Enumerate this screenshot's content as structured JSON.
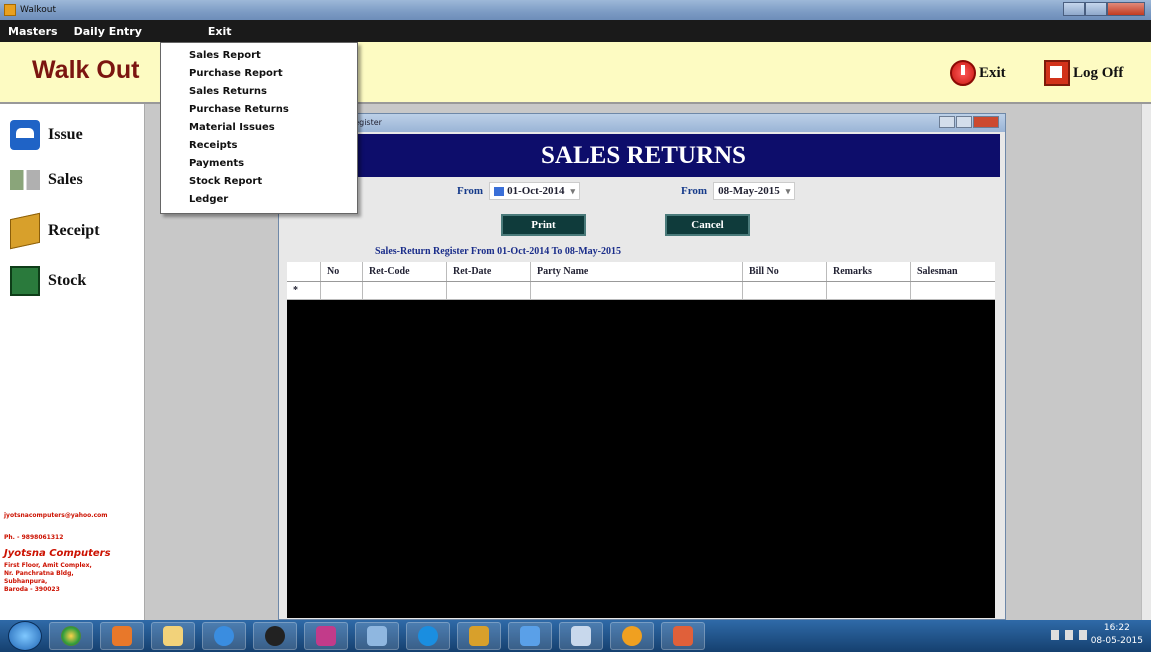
{
  "window": {
    "title": "Walkout"
  },
  "menubar": {
    "items": [
      "Masters",
      "Daily Entry",
      "Exit"
    ]
  },
  "dropdown": {
    "items": [
      "Sales Report",
      "Purchase Report",
      "Sales Returns",
      "Purchase Returns",
      "Material Issues",
      "Receipts",
      "Payments",
      "Stock Report",
      "Ledger"
    ]
  },
  "header": {
    "brand": "Walk Out",
    "exit_label": "Exit",
    "logoff_label": "Log Off"
  },
  "sidebar": {
    "items": [
      {
        "label": "Issue",
        "icon": "issue-icon"
      },
      {
        "label": "Sales",
        "icon": "sales-icon"
      },
      {
        "label": "Receipt",
        "icon": "receipt-icon"
      },
      {
        "label": "Stock",
        "icon": "stock-icon"
      }
    ],
    "contact": {
      "email": "jyotsnacomputers@yahoo.com",
      "phone": "Ph. - 9898061312",
      "company": "Jyotsna Computers",
      "address1": "First Floor, Amit Complex,",
      "address2": "Nr. Panchratna Bldg,",
      "address3": "Subhanpura,",
      "address4": "Baroda - 390023"
    }
  },
  "report_window": {
    "title": "Register",
    "banner": "SALES RETURNS",
    "from_label": "From",
    "from_date": "01-Oct-2014",
    "to_label": "From",
    "to_date": "08-May-2015",
    "print_label": "Print",
    "cancel_label": "Cancel",
    "subtitle": "Sales-Return Register From 01-Oct-2014 To 08-May-2015",
    "columns": [
      "No",
      "Ret-Code",
      "Ret-Date",
      "Party Name",
      "Bill No",
      "Remarks",
      "Salesman"
    ],
    "new_row_marker": "*"
  },
  "taskbar": {
    "time": "16:22",
    "date": "08-05-2015"
  }
}
